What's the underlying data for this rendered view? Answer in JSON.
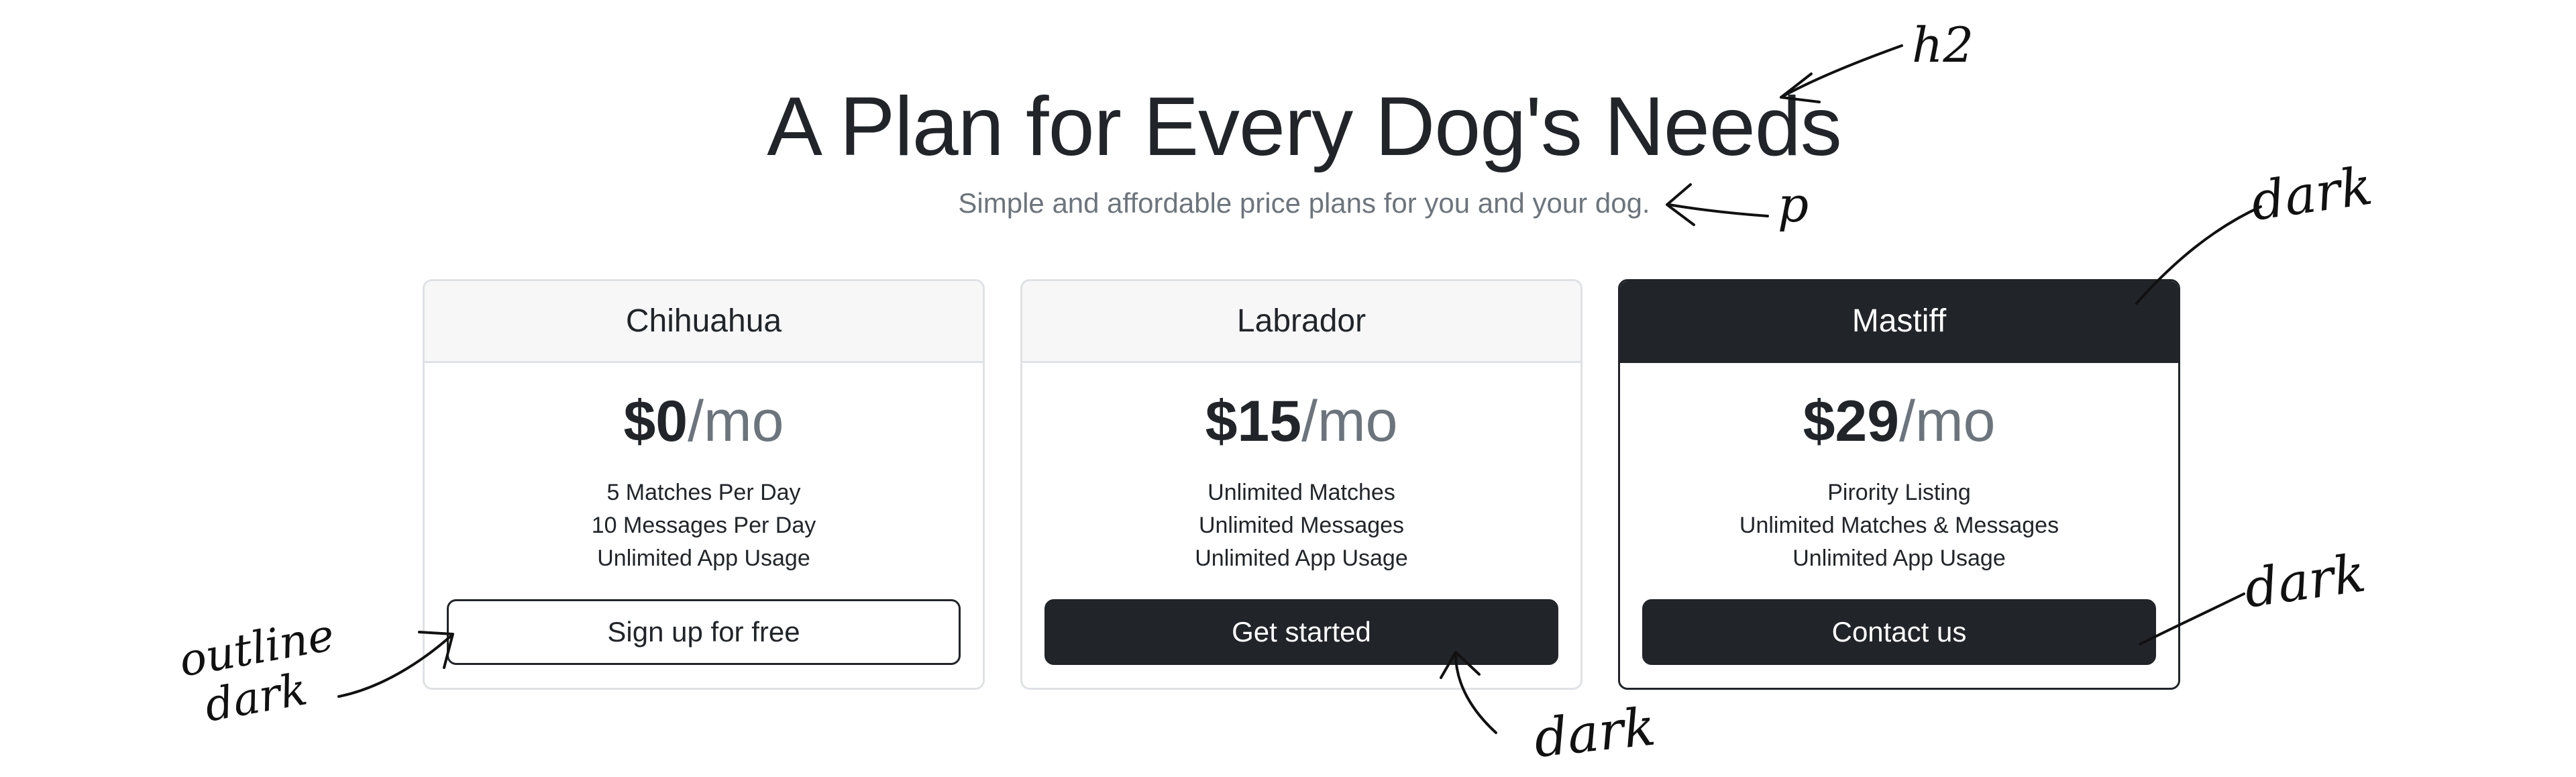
{
  "hero": {
    "title": "A Plan for Every Dog's Needs",
    "subtitle": "Simple and affordable price plans for you and your dog."
  },
  "plans": [
    {
      "name": "Chihuahua",
      "price": "$0",
      "period": "/mo",
      "features": [
        "5 Matches Per Day",
        "10 Messages Per Day",
        "Unlimited App Usage"
      ],
      "button_label": "Sign up for free",
      "button_style": "outline-dark"
    },
    {
      "name": "Labrador",
      "price": "$15",
      "period": "/mo",
      "features": [
        "Unlimited Matches",
        "Unlimited Messages",
        "Unlimited App Usage"
      ],
      "button_label": "Get started",
      "button_style": "dark"
    },
    {
      "name": "Mastiff",
      "price": "$29",
      "period": "/mo",
      "features": [
        "Pirority Listing",
        "Unlimited Matches & Messages",
        "Unlimited App Usage"
      ],
      "button_label": "Contact us",
      "button_style": "dark",
      "card_style": "dark"
    }
  ],
  "annotations": {
    "h2": "h2",
    "p": "p",
    "header_dark": "dark",
    "outline_dark_line1": "outline",
    "outline_dark_line2": "dark",
    "get_started_dark": "dark",
    "contact_dark": "dark"
  },
  "colors": {
    "dark": "#212529",
    "muted": "#6c757d",
    "border": "#dfe1e4",
    "header_bg": "#f7f7f7"
  }
}
